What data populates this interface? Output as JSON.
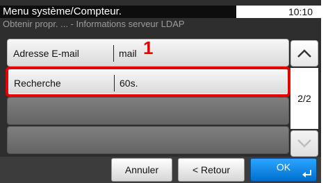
{
  "header": {
    "title": "Menu système/Compteur.",
    "subtitle": "Obtenir propr. ... - Informations serveur LDAP",
    "time": "10:10"
  },
  "list": {
    "rows": [
      {
        "label": "Adresse E-mail",
        "value": "mail"
      },
      {
        "label": "Recherche",
        "value": "60s."
      }
    ]
  },
  "annotation": {
    "marker": "1"
  },
  "pagination": {
    "page": "2/2"
  },
  "footer": {
    "cancel_label": "Annuler",
    "back_label": "< Retour",
    "ok_label": "OK"
  },
  "colors": {
    "highlight": "#e60000",
    "ok_button": "#0a84e8",
    "background": "#2e2e2e"
  }
}
